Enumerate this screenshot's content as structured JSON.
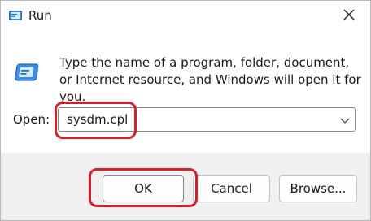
{
  "window": {
    "title": "Run",
    "app_icon": "run-app-icon",
    "close_icon": "close-icon"
  },
  "body": {
    "description": "Type the name of a program, folder, document, or Internet resource, and Windows will open it for you.",
    "run_icon": "run-dialog-icon"
  },
  "open_field": {
    "label": "Open:",
    "value": "sysdm.cpl",
    "dropdown_icon": "chevron-down-icon"
  },
  "buttons": {
    "ok": "OK",
    "cancel": "Cancel",
    "browse": "Browse..."
  },
  "annotations": {
    "highlight_color": "#d5202a",
    "highlighted": [
      "open-field",
      "ok-button"
    ]
  }
}
